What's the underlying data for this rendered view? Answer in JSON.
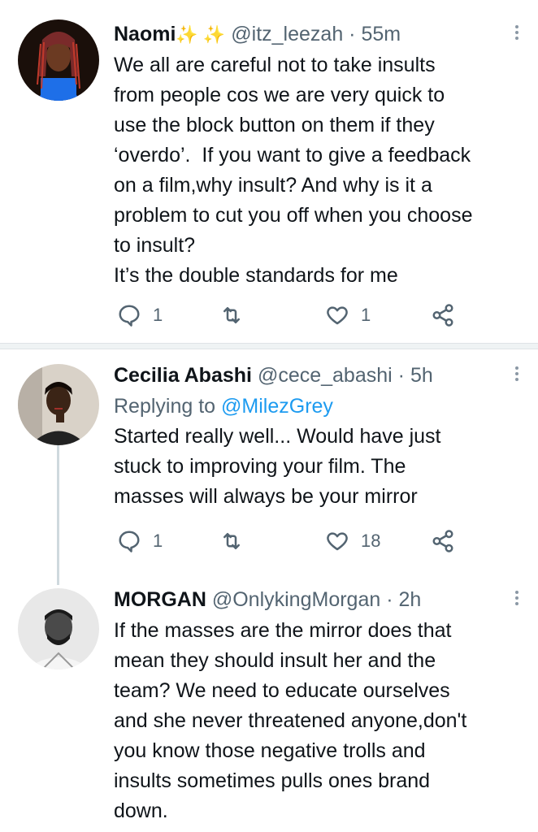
{
  "tweets": [
    {
      "name": "Naomi",
      "sparkles": "✨ ✨",
      "handle": "@itz_leezah",
      "dot": "·",
      "time": "55m",
      "body": "We all are careful not to take insults\nfrom people cos we are very quick to\nuse the block button on them if they\n‘overdo’.  If you want to give a feedback\non a film,why insult? And why is it a\nproblem to cut you off when you choose\nto insult?\nIt’s the double standards for me",
      "replies": "1",
      "likes": "1"
    },
    {
      "name": "Cecilia Abashi",
      "handle": "@cece_abashi",
      "dot": "·",
      "time": "5h",
      "replying_label": "Replying to",
      "replying_handle": "@MilezGrey",
      "body": "Started really well... Would have just\nstuck to improving your film. The\nmasses will always be your mirror",
      "replies": "1",
      "likes": "18"
    },
    {
      "name": "MORGAN",
      "handle": "@OnlykingMorgan",
      "dot": "·",
      "time": "2h",
      "body": "If the masses are the mirror does that\nmean they should insult her and the\nteam? We need to educate ourselves\nand she never threatened anyone,don't\nyou know those negative trolls and\ninsults sometimes pulls ones brand\ndown."
    }
  ],
  "icons": {
    "reply": "reply-icon",
    "retweet": "retweet-icon",
    "like": "heart-icon",
    "share": "share-icon",
    "more": "more-options-icon"
  },
  "colors": {
    "link": "#1d9bf0",
    "secondary": "#536471",
    "divider": "#eff3f4"
  }
}
